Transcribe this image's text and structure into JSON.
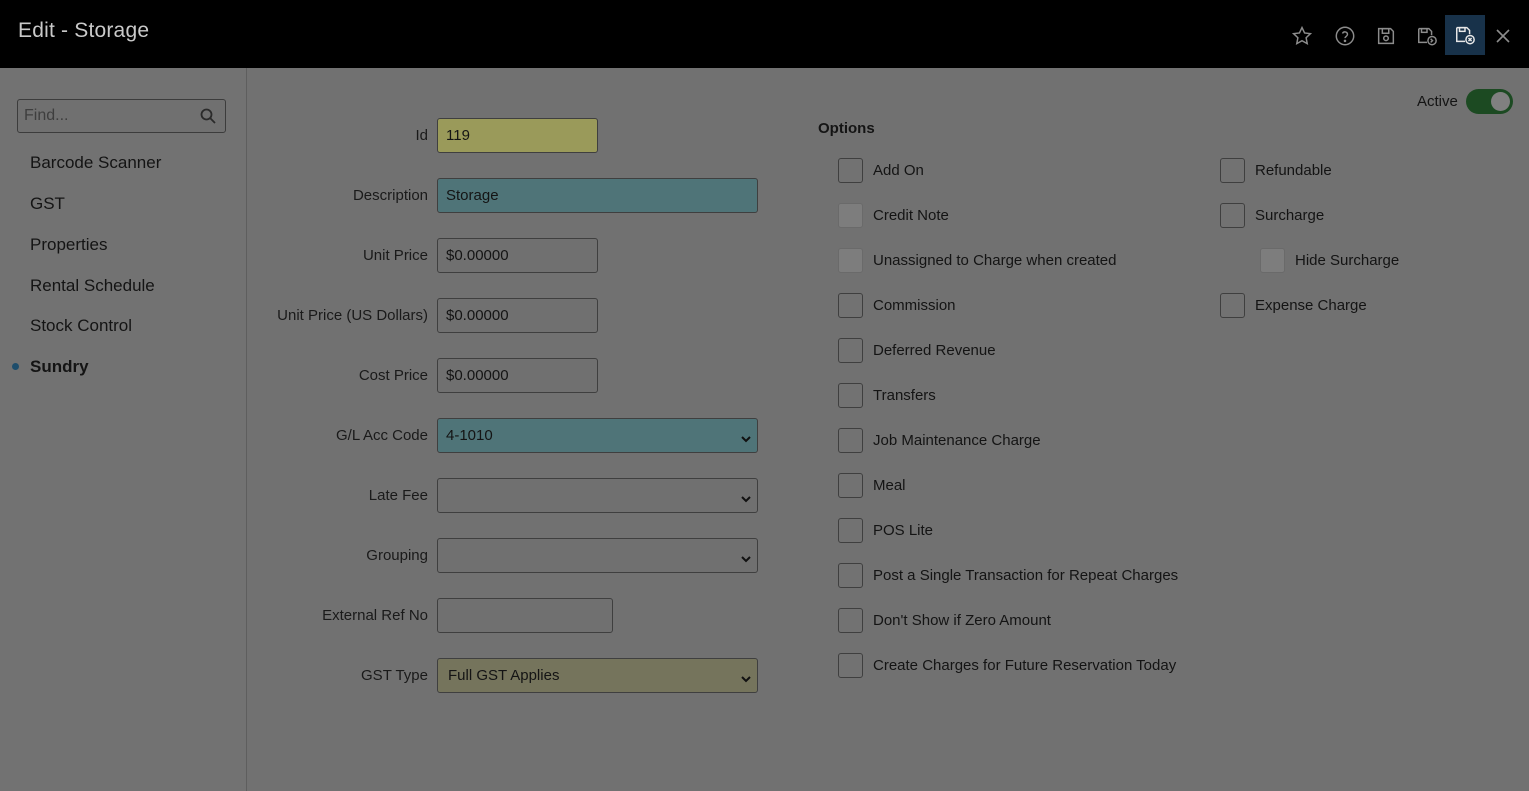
{
  "window": {
    "title": "Edit - Storage",
    "toolbar": {
      "favourite_icon": "star-icon",
      "help_icon": "help-circle-icon",
      "save_icon": "save-icon",
      "save_new_icon": "save-and-new-icon",
      "save_close_icon": "save-and-close-icon",
      "close_icon": "close-icon"
    }
  },
  "sidebar": {
    "search_placeholder": "Find...",
    "items": [
      {
        "label": "Barcode Scanner",
        "active": false
      },
      {
        "label": "GST",
        "active": false
      },
      {
        "label": "Properties",
        "active": false
      },
      {
        "label": "Rental Schedule",
        "active": false
      },
      {
        "label": "Stock Control",
        "active": false
      },
      {
        "label": "Sundry",
        "active": true
      }
    ]
  },
  "form": {
    "active_label": "Active",
    "active": true,
    "fields": {
      "id": {
        "label": "Id",
        "value": "119"
      },
      "description": {
        "label": "Description",
        "value": "Storage"
      },
      "unit_price": {
        "label": "Unit Price",
        "value": "$0.00000"
      },
      "unit_price_usd": {
        "label": "Unit Price (US Dollars)",
        "value": "$0.00000"
      },
      "cost_price": {
        "label": "Cost Price",
        "value": "$0.00000"
      },
      "gl_acc_code": {
        "label": "G/L Acc Code",
        "value": "4-1010"
      },
      "late_fee": {
        "label": "Late Fee",
        "value": ""
      },
      "grouping": {
        "label": "Grouping",
        "value": ""
      },
      "external_ref": {
        "label": "External Ref No",
        "value": ""
      },
      "gst_type": {
        "label": "GST Type",
        "value": "Full GST Applies"
      }
    }
  },
  "options": {
    "title": "Options",
    "left": [
      {
        "label": "Add On",
        "checked": false,
        "disabled": false
      },
      {
        "label": "Credit Note",
        "checked": false,
        "disabled": true
      },
      {
        "label": "Unassigned to Charge when created",
        "checked": false,
        "disabled": true
      },
      {
        "label": "Commission",
        "checked": false,
        "disabled": false
      },
      {
        "label": "Deferred Revenue",
        "checked": false,
        "disabled": false
      },
      {
        "label": "Transfers",
        "checked": false,
        "disabled": false
      },
      {
        "label": "Job Maintenance Charge",
        "checked": false,
        "disabled": false
      },
      {
        "label": "Meal",
        "checked": false,
        "disabled": false
      },
      {
        "label": "POS Lite",
        "checked": false,
        "disabled": false
      },
      {
        "label": "Post a Single Transaction for Repeat Charges",
        "checked": false,
        "disabled": false
      },
      {
        "label": "Don't Show if Zero Amount",
        "checked": false,
        "disabled": false
      },
      {
        "label": "Create Charges for Future Reservation Today",
        "checked": false,
        "disabled": false
      }
    ],
    "right": [
      {
        "label": "Refundable",
        "checked": false,
        "disabled": false
      },
      {
        "label": "Surcharge",
        "checked": false,
        "disabled": false
      },
      {
        "label": "Hide Surcharge",
        "checked": false,
        "disabled": true
      },
      {
        "label": "Expense Charge",
        "checked": false,
        "disabled": false
      }
    ]
  }
}
